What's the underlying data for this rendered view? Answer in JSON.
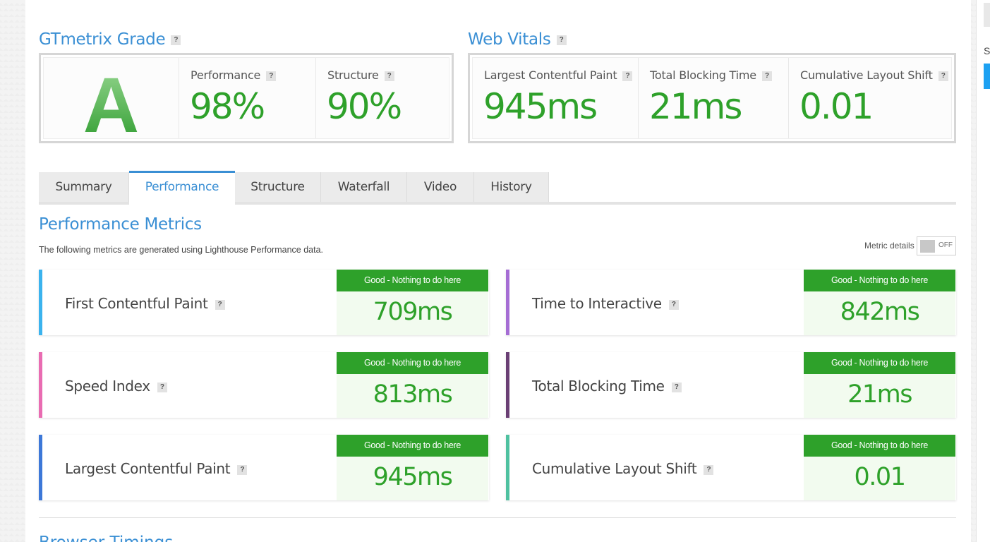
{
  "header": {
    "gtmetrix_grade_title": "GTmetrix Grade",
    "web_vitals_title": "Web Vitals",
    "help_glyph": "?"
  },
  "grade": {
    "letter": "A",
    "performance_label": "Performance",
    "performance_value": "98%",
    "structure_label": "Structure",
    "structure_value": "90%"
  },
  "web_vitals": {
    "lcp_label": "Largest Contentful Paint",
    "lcp_value": "945ms",
    "tbt_label": "Total Blocking Time",
    "tbt_value": "21ms",
    "cls_label": "Cumulative Layout Shift",
    "cls_value": "0.01"
  },
  "tabs": [
    {
      "label": "Summary"
    },
    {
      "label": "Performance"
    },
    {
      "label": "Structure"
    },
    {
      "label": "Waterfall"
    },
    {
      "label": "Video"
    },
    {
      "label": "History"
    }
  ],
  "active_tab": "Performance",
  "performance_metrics": {
    "title": "Performance Metrics",
    "description": "The following metrics are generated using Lighthouse Performance data.",
    "metric_details_label": "Metric details",
    "toggle_state": "OFF",
    "items": [
      {
        "label": "First Contentful Paint",
        "badge": "Good - Nothing to do here",
        "value": "709ms",
        "color": "#3bb3ee"
      },
      {
        "label": "Time to Interactive",
        "badge": "Good - Nothing to do here",
        "value": "842ms",
        "color": "#a56dd4"
      },
      {
        "label": "Speed Index",
        "badge": "Good - Nothing to do here",
        "value": "813ms",
        "color": "#e96cb2"
      },
      {
        "label": "Total Blocking Time",
        "badge": "Good - Nothing to do here",
        "value": "21ms",
        "color": "#6a3f74"
      },
      {
        "label": "Largest Contentful Paint",
        "badge": "Good - Nothing to do here",
        "value": "945ms",
        "color": "#3d78d8"
      },
      {
        "label": "Cumulative Layout Shift",
        "badge": "Good - Nothing to do here",
        "value": "0.01",
        "color": "#4fc1a0"
      }
    ]
  },
  "colors": {
    "accent_blue": "#3a8fd4",
    "good_green": "#2ea12a"
  }
}
